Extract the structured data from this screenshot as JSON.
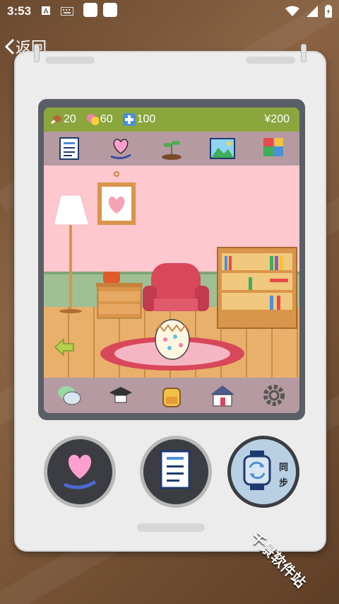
{
  "status_bar": {
    "time": "3:53"
  },
  "nav": {
    "back_label": "返回"
  },
  "hud": {
    "food": "20",
    "mood": "60",
    "health": "100",
    "money": "¥200"
  },
  "top_menu": [
    "report-card-icon",
    "heart-hand-icon",
    "sprout-icon",
    "landscape-photo-icon",
    "puzzle-icon"
  ],
  "bottom_menu": [
    "chat-bubbles-icon",
    "graduation-cap-icon",
    "backpack-icon",
    "house-icon",
    "settings-gear-icon"
  ],
  "controls": {
    "sync_label": "同步"
  },
  "watermark": "千景软件站",
  "colors": {
    "hud_green": "#8aa63c",
    "menu_bar": "#b59aa1",
    "wall_pink": "#ffc7ce",
    "device_body": "#ececec"
  }
}
